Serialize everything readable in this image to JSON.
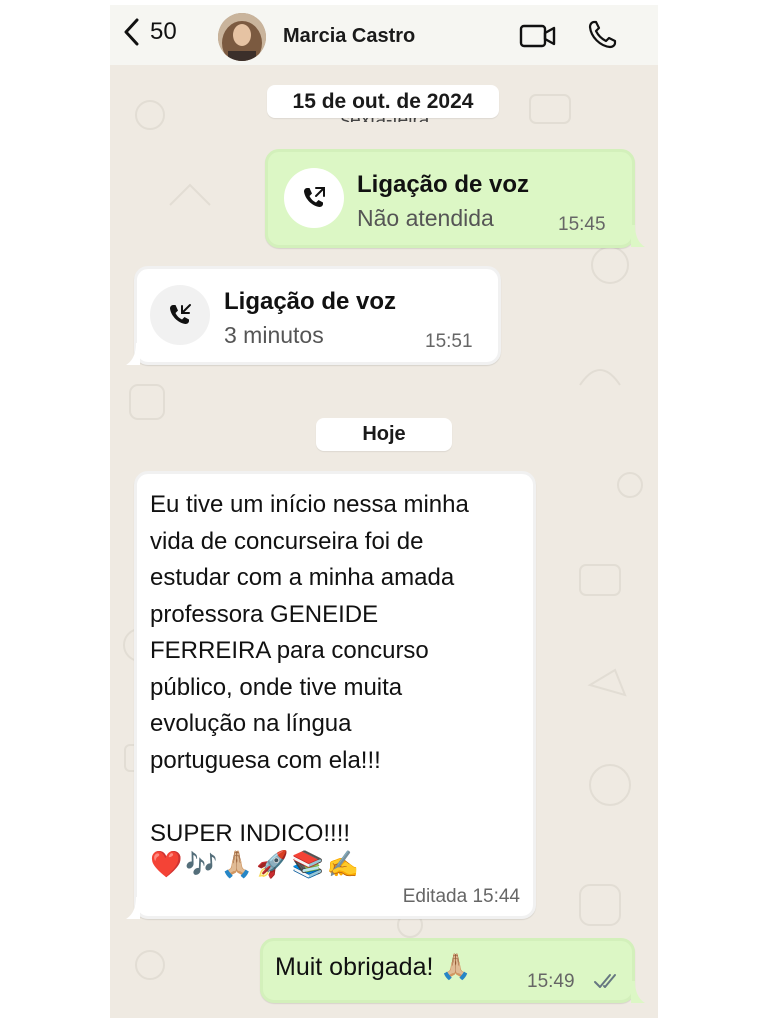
{
  "header": {
    "back_count": "50",
    "contact_name": "Marcia Castro",
    "icons": [
      "chevron-left-icon",
      "video-camera-icon",
      "phone-icon"
    ]
  },
  "chips": {
    "date": "15 de out. de 2024",
    "weekday_hidden": "sexta-feira",
    "today": "Hoje"
  },
  "messages": {
    "call_out": {
      "title": "Ligação de voz",
      "status": "Não atendida",
      "time": "15:45"
    },
    "call_in": {
      "title": "Ligação de voz",
      "status": "3 minutos",
      "time": "15:51"
    },
    "text_in": {
      "body": "Eu tive um início nessa minha\nvida de concurseira foi de\nestudar com a minha amada\nprofessora GENEIDE\nFERREIRA para concurso\npúblico, onde tive muita\nevolução na língua\nportuguesa com ela!!!\n\nSUPER INDICO!!!!",
      "emojis": "❤️🎶🙏🏼🚀📚✍️",
      "edited_label": "Editada",
      "time": "15:44"
    },
    "text_out": {
      "body": "Muit obrigada! 🙏🏼",
      "time": "15:49"
    }
  },
  "colors": {
    "background": "#efeae2",
    "outgoing_bubble": "#dcf7c5",
    "incoming_bubble": "#ffffff",
    "header": "#f6f6f2",
    "read_ticks": "#667781"
  }
}
